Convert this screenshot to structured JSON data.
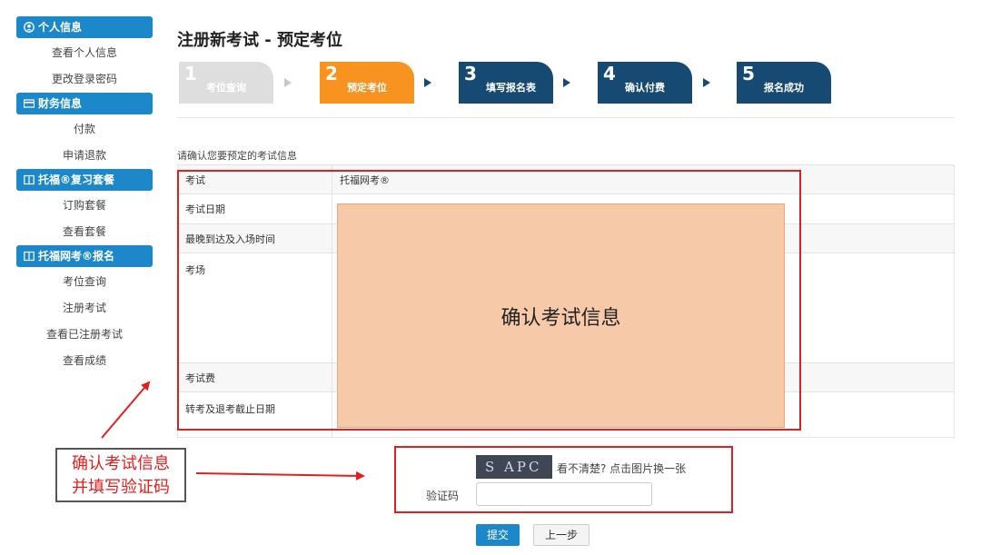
{
  "sidebar": {
    "sections": [
      {
        "title": "个人信息",
        "icon": "user-circle-icon",
        "items": [
          "查看个人信息",
          "更改登录密码"
        ]
      },
      {
        "title": "财务信息",
        "icon": "credit-card-icon",
        "items": [
          "付款",
          "申请退款"
        ]
      },
      {
        "title": "托福®复习套餐",
        "icon": "book-icon",
        "items": [
          "订购套餐",
          "查看套餐"
        ]
      },
      {
        "title": "托福网考®报名",
        "icon": "book-icon",
        "items": [
          "考位查询",
          "注册考试",
          "查看已注册考试",
          "查看成绩"
        ]
      }
    ]
  },
  "page": {
    "title": "注册新考试 - 预定考位",
    "steps": [
      {
        "num": "1",
        "label": "考位查询"
      },
      {
        "num": "2",
        "label": "预定考位"
      },
      {
        "num": "3",
        "label": "填写报名表"
      },
      {
        "num": "4",
        "label": "确认付费"
      },
      {
        "num": "5",
        "label": "报名成功"
      }
    ],
    "active_step": 2,
    "confirm_title": "请确认您要预定的考试信息",
    "table": [
      {
        "key": "考试",
        "value": "托福网考®"
      },
      {
        "key": "考试日期",
        "value": ""
      },
      {
        "key": "最晚到达及入场时间",
        "value": ""
      },
      {
        "key": "考场",
        "value": ""
      },
      {
        "key": "考试费",
        "value": ""
      },
      {
        "key": "转考及退考截止日期",
        "value": ""
      }
    ],
    "overlay_text": "确认考试信息",
    "captcha": {
      "image_text": "S APC",
      "hint": "看不清楚? 点击图片换一张",
      "label": "验证码",
      "value": ""
    },
    "buttons": {
      "submit": "提交",
      "prev": "上一步"
    },
    "callout": {
      "line1": "确认考试信息",
      "line2": "并填写验证码"
    }
  },
  "colors": {
    "accent": "#1c88c9",
    "active_step": "#f7931e",
    "todo_step": "#174a73",
    "done_step": "#dedede",
    "annotation_red": "#e02020",
    "overlay": "#f6caa9"
  }
}
